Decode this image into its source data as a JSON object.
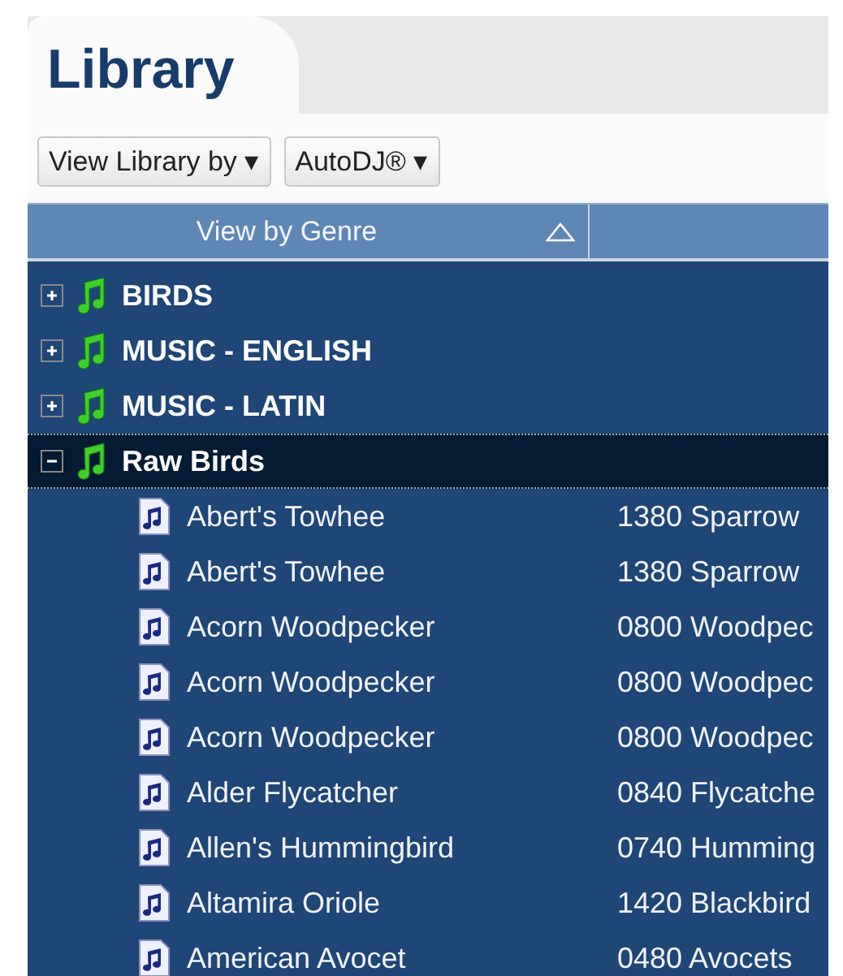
{
  "tab": {
    "title": "Library"
  },
  "toolbar": [
    {
      "label": "View Library by",
      "caret": "▾"
    },
    {
      "label": "AutoDJ®",
      "caret": "▾"
    }
  ],
  "header": {
    "column_1": "View by Genre",
    "sorted_ascending": true
  },
  "tree": [
    {
      "label": "BIRDS",
      "expanded": false,
      "selected": false
    },
    {
      "label": "MUSIC - ENGLISH",
      "expanded": false,
      "selected": false
    },
    {
      "label": "MUSIC - LATIN",
      "expanded": false,
      "selected": false
    },
    {
      "label": "Raw Birds",
      "expanded": true,
      "selected": true,
      "children": [
        {
          "title": "Abert's Towhee",
          "column_2": "1380 Sparrow"
        },
        {
          "title": "Abert's Towhee",
          "column_2": "1380 Sparrow"
        },
        {
          "title": "Acorn Woodpecker",
          "column_2": "0800 Woodpec"
        },
        {
          "title": "Acorn Woodpecker",
          "column_2": "0800 Woodpec"
        },
        {
          "title": "Acorn Woodpecker",
          "column_2": "0800 Woodpec"
        },
        {
          "title": "Alder Flycatcher",
          "column_2": "0840 Flycatche"
        },
        {
          "title": "Allen's Hummingbird",
          "column_2": "0740 Humming"
        },
        {
          "title": "Altamira Oriole",
          "column_2": "1420 Blackbird"
        },
        {
          "title": "American Avocet",
          "column_2": "0480 Avocets"
        }
      ]
    }
  ]
}
